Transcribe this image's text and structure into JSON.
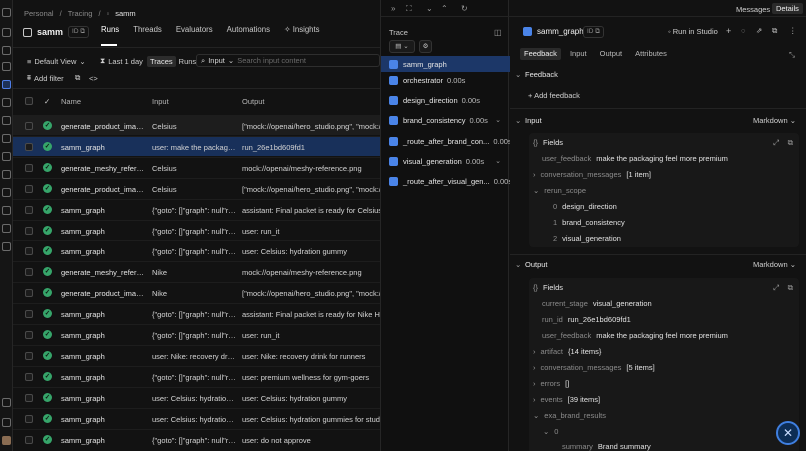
{
  "breadcrumb": {
    "org": "Personal",
    "section": "Tracing",
    "project": "samm"
  },
  "project": {
    "name": "samm",
    "id_label": "ID"
  },
  "tabs": [
    {
      "label": "Runs"
    },
    {
      "label": "Threads"
    },
    {
      "label": "Evaluators"
    },
    {
      "label": "Automations"
    },
    {
      "label": "Insights"
    }
  ],
  "toolbar": {
    "view": "Default View",
    "time": "Last 1 day",
    "traces": "Traces",
    "runs": "Runs",
    "search_scope": "Input",
    "search_placeholder": "Search input content",
    "add_filter": "Add filter"
  },
  "table": {
    "columns": {
      "name": "Name",
      "input": "Input",
      "output": "Output"
    },
    "rows": [
      {
        "name": "generate_product_images",
        "input": "Celsius",
        "output": "[\"mock://openai/hero_studio.png\", \"mock://ope"
      },
      {
        "name": "samm_graph",
        "input": "user: make the packagin...",
        "output": "run_26e1bd609fd1"
      },
      {
        "name": "generate_meshy_referen...",
        "input": "Celsius",
        "output": "mock://openai/meshy-reference.png"
      },
      {
        "name": "generate_product_images",
        "input": "Celsius",
        "output": "[\"mock://openai/hero_studio.png\", \"mock://ope"
      },
      {
        "name": "samm_graph",
        "input": "{\"goto\": []\"graph\": null\"re...",
        "output": "assistant: Final packet is ready for Celsius Hyda"
      },
      {
        "name": "samm_graph",
        "input": "{\"goto\": []\"graph\": null\"re...",
        "output": "user: run_it"
      },
      {
        "name": "samm_graph",
        "input": "{\"goto\": []\"graph\": null\"re...",
        "output": "user: Celsius: hydration gummy"
      },
      {
        "name": "generate_meshy_referen...",
        "input": "Nike",
        "output": "mock://openai/meshy-reference.png"
      },
      {
        "name": "generate_product_images",
        "input": "Nike",
        "output": "[\"mock://openai/hero_studio.png\", \"mock://ope"
      },
      {
        "name": "samm_graph",
        "input": "{\"goto\": []\"graph\": null\"re...",
        "output": "assistant: Final packet is ready for Nike Hydrat"
      },
      {
        "name": "samm_graph",
        "input": "{\"goto\": []\"graph\": null\"re...",
        "output": "user: run_it"
      },
      {
        "name": "samm_graph",
        "input": "user: Nike: recovery drin...",
        "output": "user: Nike: recovery drink for runners"
      },
      {
        "name": "samm_graph",
        "input": "{\"goto\": []\"graph\": null\"re...",
        "output": "user: premium wellness for gym-goers"
      },
      {
        "name": "samm_graph",
        "input": "user: Celsius: hydration g...",
        "output": "user: Celsius: hydration gummy"
      },
      {
        "name": "samm_graph",
        "input": "user: Celsius: hydration g...",
        "output": "user: Celsius: hydration gummies for students a"
      },
      {
        "name": "samm_graph",
        "input": "{\"goto\": []\"graph\": null\"re...",
        "output": "user: do not approve"
      }
    ]
  },
  "trace": {
    "title": "Trace",
    "spans": [
      {
        "name": "samm_graph",
        "time": ""
      },
      {
        "name": "orchestrator",
        "time": "0.00s"
      },
      {
        "name": "design_direction",
        "time": "0.00s"
      },
      {
        "name": "brand_consistency",
        "time": "0.00s"
      },
      {
        "name": "_route_after_brand_con...",
        "time": "0.00s"
      },
      {
        "name": "visual_generation",
        "time": "0.00s"
      },
      {
        "name": "_route_after_visual_gen...",
        "time": "0.00s"
      }
    ]
  },
  "panel": {
    "messages": "Messages",
    "details": "Details",
    "title": "samm_graph",
    "id_label": "ID",
    "run_in_studio": "Run in Studio",
    "tabs": [
      {
        "label": "Feedback"
      },
      {
        "label": "Input"
      },
      {
        "label": "Output"
      },
      {
        "label": "Attributes"
      }
    ],
    "feedback": {
      "title": "Feedback",
      "add": "Add feedback"
    },
    "input": {
      "title": "Input",
      "mode": "Markdown",
      "fields": "Fields",
      "user_feedback_k": "user_feedback",
      "user_feedback_v": "make the packaging feel more premium",
      "conv_k": "conversation_messages",
      "conv_v": "[1 item]",
      "rerun_k": "rerun_scope",
      "rerun": [
        {
          "i": "0",
          "v": "design_direction"
        },
        {
          "i": "1",
          "v": "brand_consistency"
        },
        {
          "i": "2",
          "v": "visual_generation"
        }
      ]
    },
    "output": {
      "title": "Output",
      "mode": "Markdown",
      "fields": "Fields",
      "stage_k": "current_stage",
      "stage_v": "visual_generation",
      "run_k": "run_id",
      "run_v": "run_26e1bd609fd1",
      "uf_k": "user_feedback",
      "uf_v": "make the packaging feel more premium",
      "artifact_k": "artifact",
      "artifact_v": "{14 items}",
      "conv_k": "conversation_messages",
      "conv_v": "[5 items]",
      "errors_k": "errors",
      "errors_v": "[]",
      "events_k": "events",
      "events_v": "[39 items]",
      "exa_k": "exa_brand_results",
      "idx0": "0",
      "summary_k": "summary",
      "summary_v": "Brand summary"
    }
  },
  "colors": {
    "accent": "#4a84e8",
    "selected_row": "#18305a",
    "success": "#36a56a"
  }
}
